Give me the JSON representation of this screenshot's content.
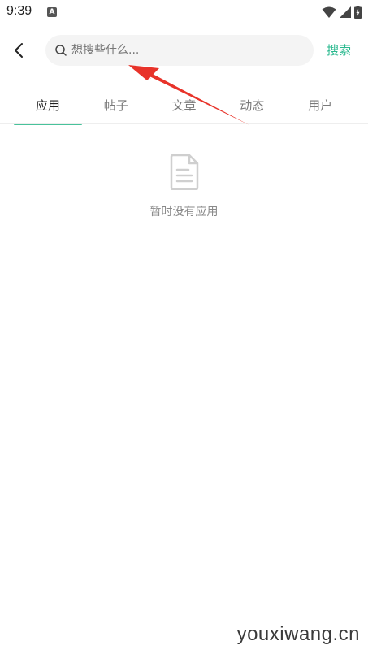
{
  "status_bar": {
    "time": "9:39",
    "notification_icon": "A"
  },
  "search": {
    "placeholder": "想搜些什么...",
    "value": "",
    "button_label": "搜索"
  },
  "tabs": [
    {
      "label": "应用",
      "active": true
    },
    {
      "label": "帖子",
      "active": false
    },
    {
      "label": "文章",
      "active": false
    },
    {
      "label": "动态",
      "active": false
    },
    {
      "label": "用户",
      "active": false
    }
  ],
  "empty_state": {
    "icon": "document-icon",
    "text": "暂时没有应用"
  },
  "watermark": "youxiwang.cn",
  "colors": {
    "accent": "#2bb98f",
    "indicator": "#49c29b",
    "annotation_arrow": "#e8332a"
  }
}
